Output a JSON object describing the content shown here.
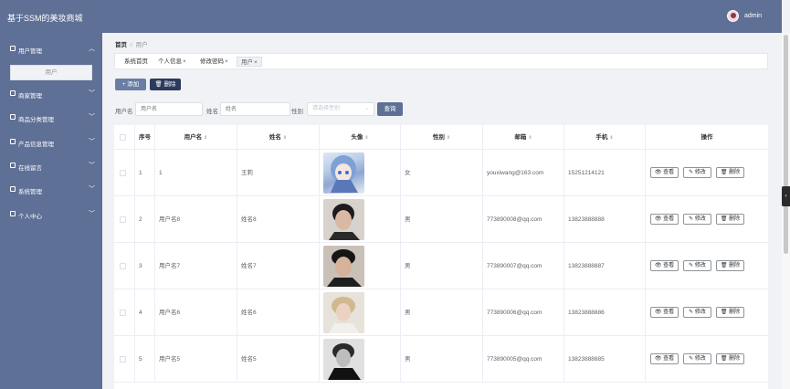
{
  "header": {
    "title": "基于SSM的美妆商城",
    "user": "admin"
  },
  "sidebar": {
    "items": [
      {
        "label": "用户管理",
        "icon": "grid-icon",
        "expanded": true
      },
      {
        "label": "商家管理",
        "icon": "grid-icon"
      },
      {
        "label": "商品分类管理",
        "icon": "list-icon"
      },
      {
        "label": "产品信息管理",
        "icon": "grid-icon"
      },
      {
        "label": "在线留言",
        "icon": "chat-icon"
      },
      {
        "label": "系统管理",
        "icon": "grid-icon"
      },
      {
        "label": "个人中心",
        "icon": "card-icon"
      }
    ],
    "submenu": "用户"
  },
  "breadcrumb": {
    "home": "首页",
    "sep": "//",
    "current": "用户"
  },
  "tabs": [
    {
      "label": "系统首页",
      "closable": false
    },
    {
      "label": "个人信息",
      "closable": true
    },
    {
      "label": "修改密码",
      "closable": true
    },
    {
      "label": "用户",
      "closable": true,
      "active": true
    }
  ],
  "toolbar": {
    "add_label": "添加",
    "delete_label": "删除"
  },
  "filter": {
    "username_label": "用户名",
    "username_placeholder": "用户名",
    "name_label": "姓名",
    "name_placeholder": "姓名",
    "gender_label": "性别",
    "gender_placeholder": "请选择性别",
    "query_label": "查询"
  },
  "table": {
    "headers": [
      "序号",
      "用户名",
      "姓名",
      "头像",
      "性别",
      "邮箱",
      "手机",
      "操作"
    ],
    "actions": {
      "view": "查看",
      "edit": "修改",
      "delete": "删除"
    },
    "rows": [
      {
        "index": "1",
        "username": "1",
        "name": "王莉",
        "gender": "女",
        "email": "youxiwang@163.com",
        "phone": "15251214121",
        "avatar": "anime"
      },
      {
        "index": "2",
        "username": "用户名8",
        "name": "姓名8",
        "gender": "男",
        "email": "773890008@qq.com",
        "phone": "13823888888",
        "avatar": "photo"
      },
      {
        "index": "3",
        "username": "用户名7",
        "name": "姓名7",
        "gender": "男",
        "email": "773890007@qq.com",
        "phone": "13823888887",
        "avatar": "photo"
      },
      {
        "index": "4",
        "username": "用户名6",
        "name": "姓名6",
        "gender": "男",
        "email": "773890006@qq.com",
        "phone": "13823888886",
        "avatar": "photo-light"
      },
      {
        "index": "5",
        "username": "用户名5",
        "name": "姓名5",
        "gender": "男",
        "email": "773890005@qq.com",
        "phone": "13823888885",
        "avatar": "photo-bw"
      }
    ]
  },
  "colors": {
    "sidebar": "#5f7096",
    "accent": "#2c3a5c"
  }
}
